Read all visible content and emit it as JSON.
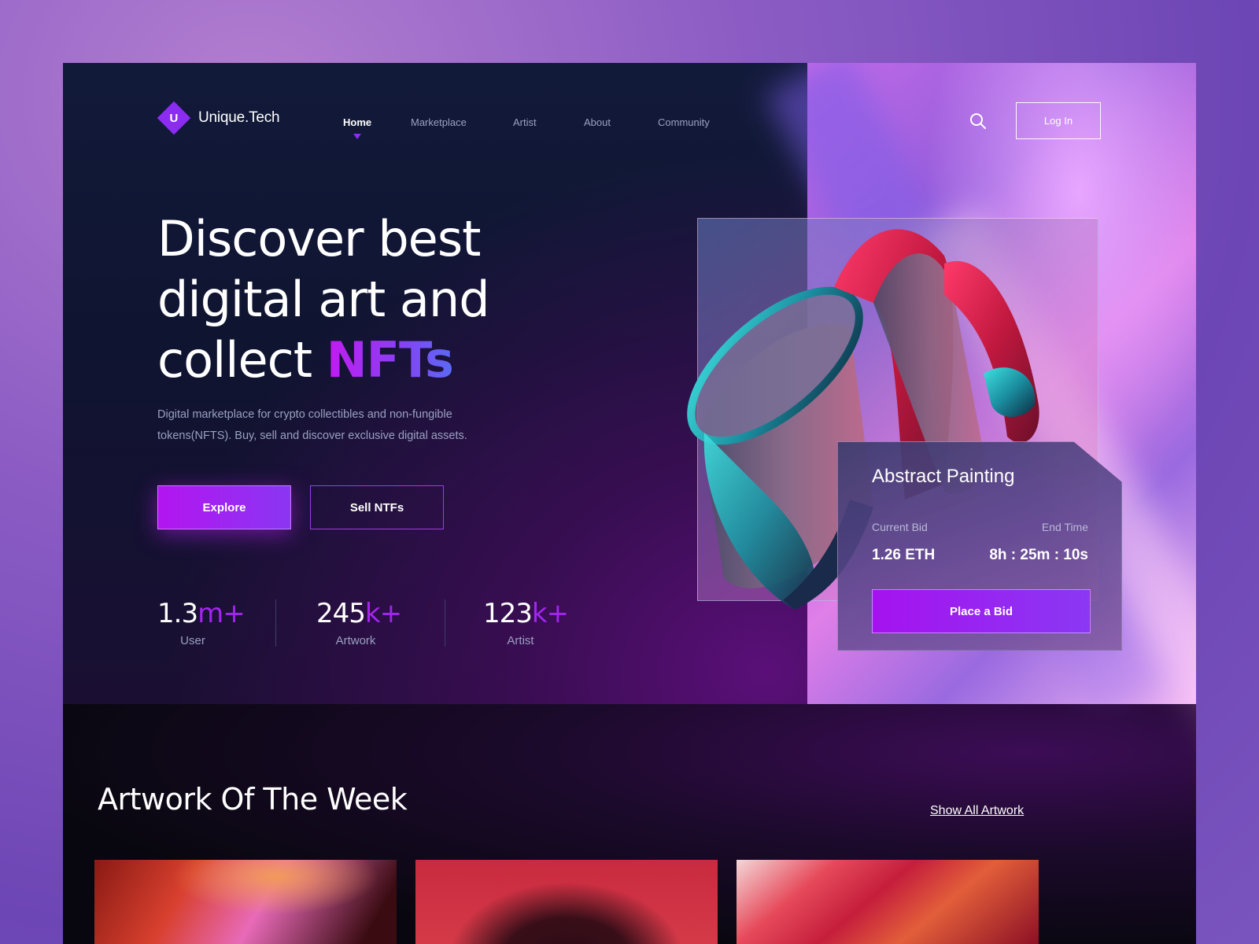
{
  "brand": {
    "logo_letter": "U",
    "name": "Unique.Tech"
  },
  "nav": {
    "items": [
      {
        "label": "Home",
        "active": true
      },
      {
        "label": "Marketplace",
        "active": false
      },
      {
        "label": "Artist",
        "active": false
      },
      {
        "label": "About",
        "active": false
      },
      {
        "label": "Community",
        "active": false
      }
    ],
    "login_label": "Log In"
  },
  "hero": {
    "headline_line1": "Discover best",
    "headline_line2": "digital art and",
    "headline_line3_prefix": "collect ",
    "headline_accent": "NFTs",
    "subtitle": "Digital marketplace for crypto collectibles and non-fungible tokens(NFTS). Buy, sell and discover exclusive digital assets.",
    "explore_label": "Explore",
    "sell_label": "Sell NTFs"
  },
  "stats": [
    {
      "value": "1.3",
      "suffix": "m+",
      "label": "User"
    },
    {
      "value": "245",
      "suffix": "k+",
      "label": "Artwork"
    },
    {
      "value": "123",
      "suffix": "k+",
      "label": "Artist"
    }
  ],
  "bid_card": {
    "title": "Abstract Painting",
    "current_bid_label": "Current Bid",
    "current_bid_value": "1.26 ETH",
    "end_time_label": "End Time",
    "end_time_value": "8h : 25m : 10s",
    "button_label": "Place a Bid"
  },
  "artwork_section": {
    "title": "Artwork Of The Week",
    "show_all_label": "Show All Artwork"
  },
  "colors": {
    "accent": "#8b2cf0",
    "accent_magenta": "#b315f0",
    "bg_dark": "#0f1430"
  },
  "icons": {
    "search": "search-icon",
    "caret": "caret-down-icon"
  }
}
